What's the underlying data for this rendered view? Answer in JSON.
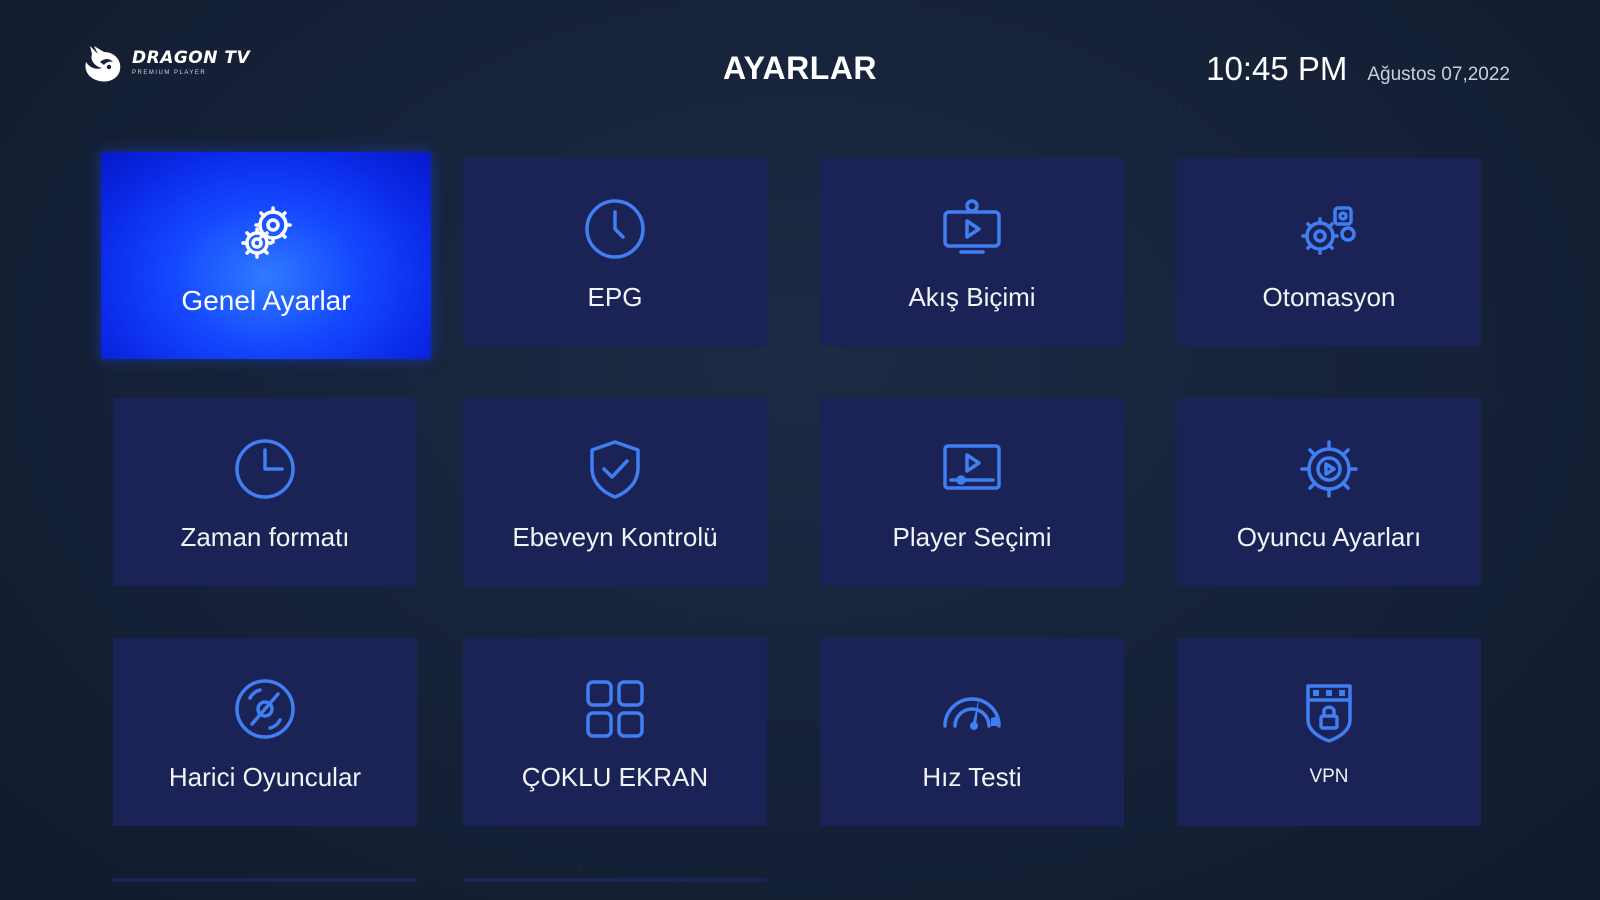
{
  "header": {
    "logo_name": "DRAGON TV",
    "logo_tagline": "PREMIUM PLAYER",
    "title": "AYARLAR",
    "time": "10:45 PM",
    "date": "Ağustos 07,2022"
  },
  "colors": {
    "background": "#17233a",
    "tile": "#1b2356",
    "selected_tile": "#1448ff",
    "icon": "#3f7ff2"
  },
  "tiles": [
    {
      "label": "Genel Ayarlar",
      "icon": "gears-icon",
      "selected": true
    },
    {
      "label": "EPG",
      "icon": "clock-icon"
    },
    {
      "label": "Akış Biçimi",
      "icon": "stream-play-icon"
    },
    {
      "label": "Otomasyon",
      "icon": "automation-gears-icon"
    },
    {
      "label": "Zaman formatı",
      "icon": "time-format-icon"
    },
    {
      "label": "Ebeveyn Kontrolü",
      "icon": "shield-check-icon"
    },
    {
      "label": "Player Seçimi",
      "icon": "player-screen-icon"
    },
    {
      "label": "Oyuncu Ayarları",
      "icon": "player-gear-icon"
    },
    {
      "label": "Harici Oyuncular",
      "icon": "disc-icon"
    },
    {
      "label": "ÇOKLU EKRAN",
      "icon": "multi-screen-icon"
    },
    {
      "label": "Hız Testi",
      "icon": "speedometer-icon"
    },
    {
      "label": "VPN",
      "icon": "vpn-shield-icon"
    }
  ]
}
